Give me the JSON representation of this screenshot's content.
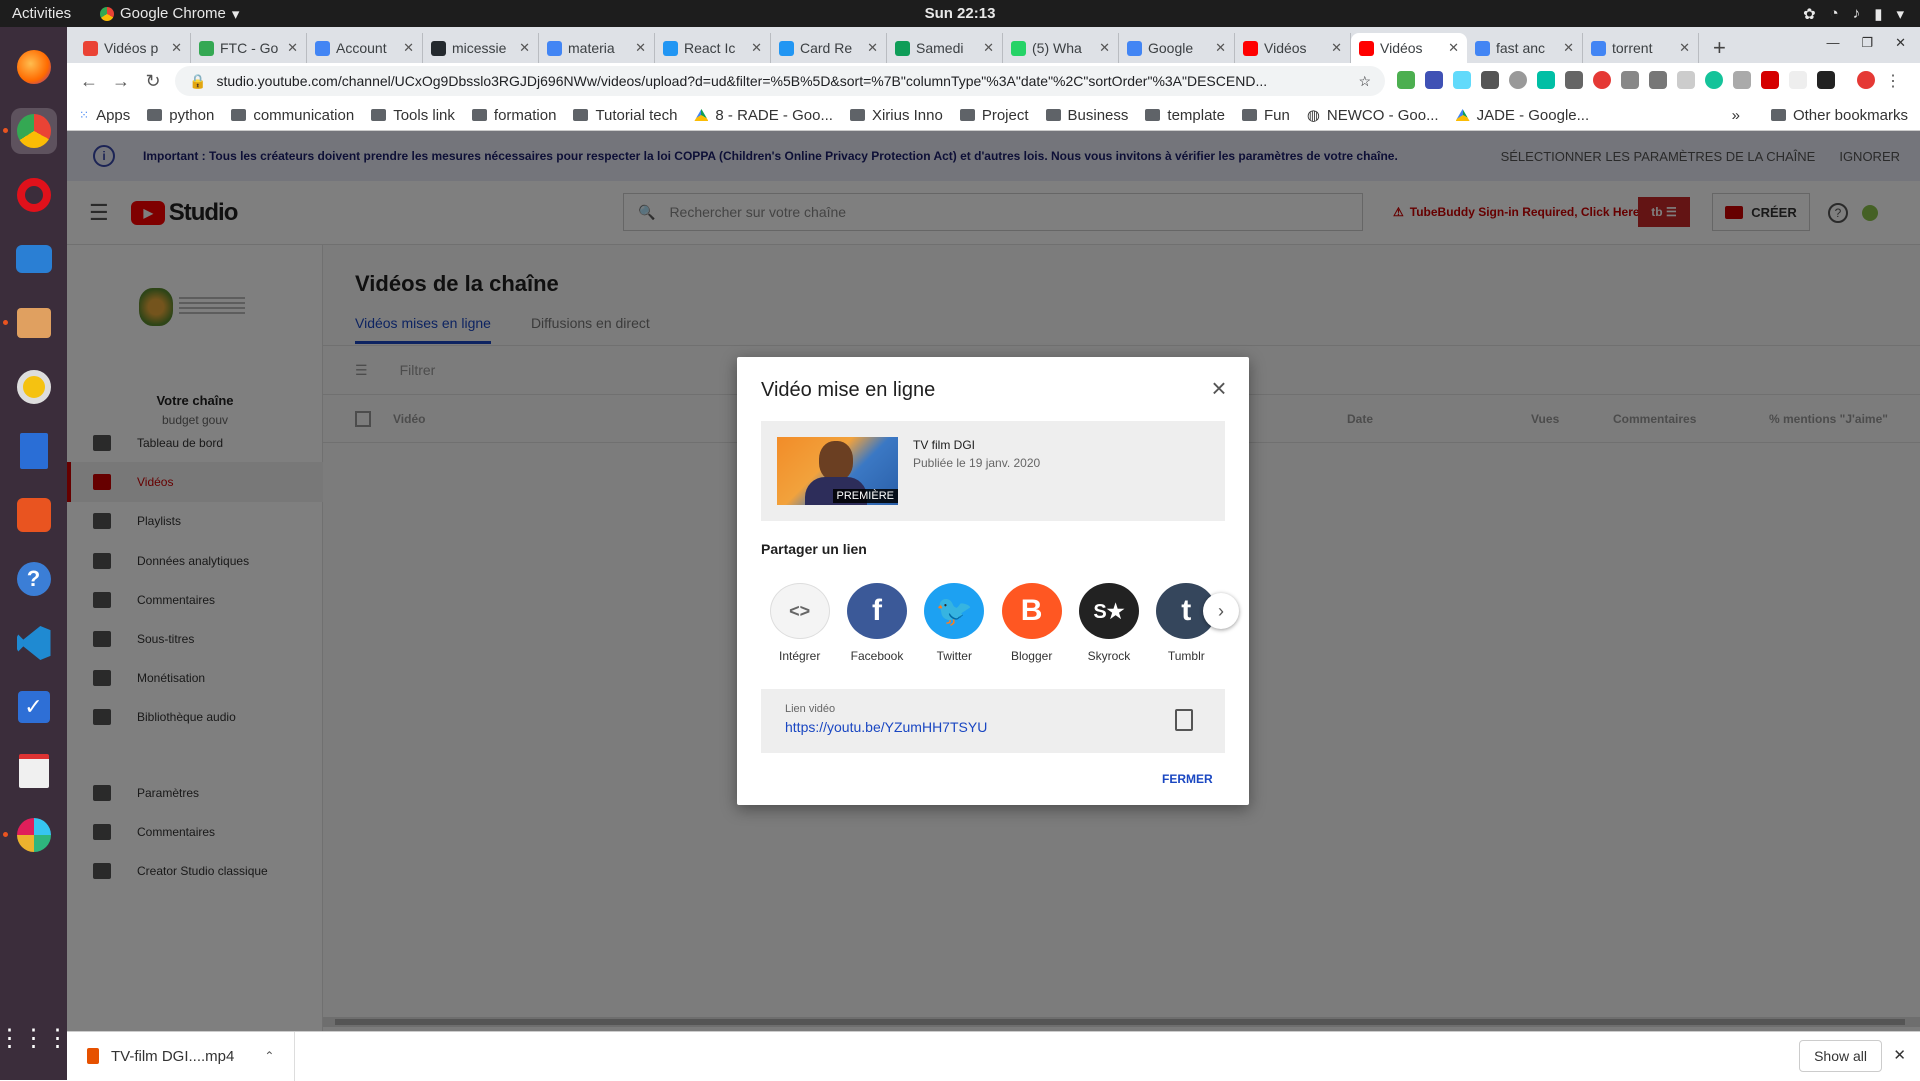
{
  "system": {
    "activities": "Activities",
    "app_name": "Google Chrome",
    "app_menu_arrow": "▾",
    "clock": "Sun 22:13"
  },
  "tabs": [
    {
      "label": "Vidéos p",
      "color": "#ea4335"
    },
    {
      "label": "FTC - Go",
      "color": "#34a853"
    },
    {
      "label": "Account",
      "color": "#4285f4"
    },
    {
      "label": "micessie",
      "color": "#24292e"
    },
    {
      "label": "materia",
      "color": "#4285f4"
    },
    {
      "label": "React Ic",
      "color": "#2196f3"
    },
    {
      "label": "Card Re",
      "color": "#2196f3"
    },
    {
      "label": "Samedi",
      "color": "#0f9d58"
    },
    {
      "label": "(5) Wha",
      "color": "#25d366"
    },
    {
      "label": "Google",
      "color": "#4285f4"
    },
    {
      "label": "Vidéos",
      "color": "#ff0000"
    },
    {
      "label": "Vidéos",
      "color": "#ff0000",
      "active": true
    },
    {
      "label": "fast anc",
      "color": "#4285f4"
    },
    {
      "label": "torrent",
      "color": "#4285f4"
    }
  ],
  "newtab": "+",
  "address": {
    "url": "studio.youtube.com/channel/UCxOg9Dbsslo3RGJDj696NWw/videos/upload?d=ud&filter=%5B%5D&sort=%7B\"columnType\"%3A\"date\"%2C\"sortOrder\"%3A\"DESCEND..."
  },
  "bookmarks": [
    {
      "label": "Apps",
      "icon": "apps-icon"
    },
    {
      "label": "python",
      "icon": "folder-icon"
    },
    {
      "label": "communication",
      "icon": "folder-icon"
    },
    {
      "label": "Tools link",
      "icon": "folder-icon"
    },
    {
      "label": "formation",
      "icon": "folder-icon"
    },
    {
      "label": "Tutorial tech",
      "icon": "folder-icon"
    },
    {
      "label": "8 - RADE - Goo...",
      "icon": "drive-icon"
    },
    {
      "label": "Xirius Inno",
      "icon": "folder-icon"
    },
    {
      "label": "Project",
      "icon": "folder-icon"
    },
    {
      "label": "Business",
      "icon": "folder-icon"
    },
    {
      "label": "template",
      "icon": "folder-icon"
    },
    {
      "label": "Fun",
      "icon": "folder-icon"
    },
    {
      "label": "NEWCO - Goo...",
      "icon": "globe-icon"
    },
    {
      "label": "JADE - Google...",
      "icon": "drive-icon"
    }
  ],
  "bookmarks_more": "»",
  "bookmarks_other": "Other bookmarks",
  "coppa": {
    "text": "Important : Tous les créateurs doivent prendre les mesures nécessaires pour respecter la loi COPPA (Children's Online Privacy Protection Act) et d'autres lois. Nous vous invitons à vérifier les paramètres de votre chaîne.",
    "action_settings": "SÉLECTIONNER LES PARAMÈTRES DE LA CHAÎNE",
    "action_ignore": "IGNORER"
  },
  "studio": {
    "logo_text": "Studio",
    "search_placeholder": "Rechercher sur votre chaîne",
    "tubebuddy_warning": "TubeBuddy Sign-in Required, Click Here",
    "tubebuddy_badge": "tb ☰",
    "create_label": "CRÉER",
    "help": "?"
  },
  "channel": {
    "title": "Votre chaîne",
    "subtitle": "budget gouv"
  },
  "nav": [
    {
      "label": "Tableau de bord",
      "icon": "dashboard-icon"
    },
    {
      "label": "Vidéos",
      "icon": "videos-icon",
      "selected": true
    },
    {
      "label": "Playlists",
      "icon": "playlists-icon"
    },
    {
      "label": "Données analytiques",
      "icon": "analytics-icon"
    },
    {
      "label": "Commentaires",
      "icon": "comments-icon"
    },
    {
      "label": "Sous-titres",
      "icon": "subtitles-icon"
    },
    {
      "label": "Monétisation",
      "icon": "dollar-icon"
    },
    {
      "label": "Bibliothèque audio",
      "icon": "audio-library-icon"
    },
    {
      "label": "Paramètres",
      "icon": "gear-icon"
    },
    {
      "label": "Commentaires",
      "icon": "feedback-icon"
    },
    {
      "label": "Creator Studio classique",
      "icon": "classic-studio-icon"
    }
  ],
  "main": {
    "title": "Vidéos de la chaîne",
    "tab_uploads": "Vidéos mises en ligne",
    "tab_live": "Diffusions en direct",
    "filter_placeholder": "Filtrer",
    "columns": [
      "Vidéo",
      "Date",
      "Vues",
      "Commentaires",
      "% mentions \"J'aime\""
    ]
  },
  "dialog": {
    "title": "Vidéo mise en ligne",
    "video_title": "TV film DGI",
    "video_date": "Publiée le 19 janv. 2020",
    "thumb_badge": "PREMIÈRE",
    "share_title": "Partager un lien",
    "share": [
      {
        "label": "Intégrer",
        "icon": "embed-icon",
        "color": "#f4f4f4",
        "glyph": "<>"
      },
      {
        "label": "Facebook",
        "icon": "facebook-icon",
        "color": "#3b5998",
        "glyph": "f"
      },
      {
        "label": "Twitter",
        "icon": "twitter-icon",
        "color": "#1da1f2",
        "glyph": "🐦"
      },
      {
        "label": "Blogger",
        "icon": "blogger-icon",
        "color": "#ff5722",
        "glyph": "B"
      },
      {
        "label": "Skyrock",
        "icon": "skyrock-icon",
        "color": "#222222",
        "glyph": "S★"
      },
      {
        "label": "Tumblr",
        "icon": "tumblr-icon",
        "color": "#35465c",
        "glyph": "t"
      }
    ],
    "link_label": "Lien vidéo",
    "link_url": "https://youtu.be/YZumHH7TSYU",
    "close_label": "FERMER"
  },
  "download": {
    "filename": "TV-film DGI....mp4",
    "show_all": "Show all"
  }
}
